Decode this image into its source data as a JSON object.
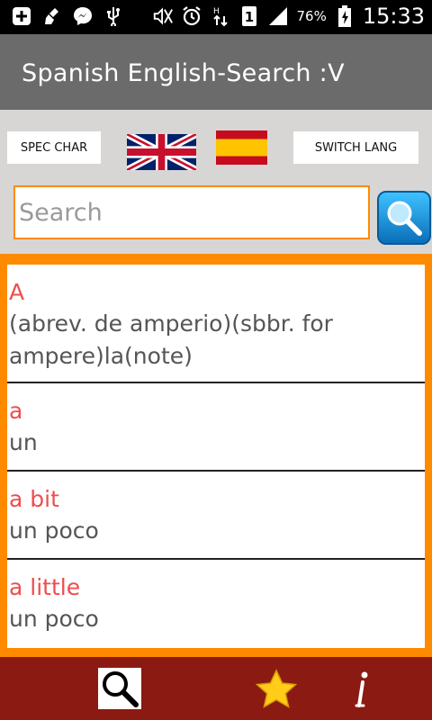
{
  "status_bar": {
    "time": "15:33",
    "battery": "76%",
    "sim": "1",
    "icons_left": [
      "plus-box-icon",
      "broom-icon",
      "messenger-icon",
      "usb-icon"
    ],
    "icons_right": [
      "mute-icon",
      "alarm-icon",
      "data-arrows-icon",
      "sim-icon",
      "signal-icon",
      "battery-icon"
    ]
  },
  "app_bar": {
    "title": "Spanish English-Search :V"
  },
  "language_row": {
    "spec_char_label": "SPEC CHAR",
    "switch_lang_label": "SWITCH LANG",
    "flags": [
      "uk-flag",
      "spain-flag"
    ]
  },
  "search": {
    "placeholder": "Search",
    "value": ""
  },
  "results": [
    {
      "term": "A",
      "translation": "(abrev. de amperio)(sbbr. for ampere)la(note)"
    },
    {
      "term": "a",
      "translation": "un"
    },
    {
      "term": "a bit",
      "translation": "un poco"
    },
    {
      "term": "a little",
      "translation": "un poco"
    }
  ],
  "bottom_bar": {
    "icons": [
      "search-icon",
      "star-icon",
      "info-icon"
    ]
  },
  "colors": {
    "accent_orange": "#ff8a00",
    "term_red": "#f04c4c",
    "bottom_bar": "#8b1a12",
    "app_bar": "#6b6b6b"
  }
}
